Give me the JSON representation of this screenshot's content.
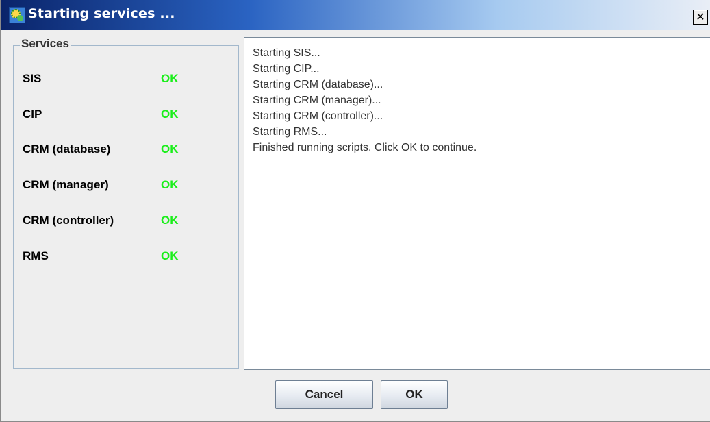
{
  "window": {
    "title": "Starting services ...",
    "close_glyph": "✕",
    "icon": "app-gear-icon"
  },
  "services": {
    "heading": "Services",
    "items": [
      {
        "name": "SIS",
        "status": "OK"
      },
      {
        "name": "CIP",
        "status": "OK"
      },
      {
        "name": "CRM (database)",
        "status": "OK"
      },
      {
        "name": "CRM (manager)",
        "status": "OK"
      },
      {
        "name": "CRM (controller)",
        "status": "OK"
      },
      {
        "name": "RMS",
        "status": "OK"
      }
    ],
    "status_color": "#1aee1a"
  },
  "log": {
    "lines": [
      "Starting SIS...",
      "Starting CIP...",
      "Starting CRM (database)...",
      "Starting CRM (manager)...",
      "Starting CRM (controller)...",
      "Starting RMS...",
      "Finished running scripts.  Click OK to continue."
    ]
  },
  "buttons": {
    "cancel_label": "Cancel",
    "ok_label": "OK"
  },
  "colors": {
    "title_bar_start": "#0a246a",
    "title_bar_end": "#e9eef6",
    "panel_border": "#a3b8cc"
  }
}
